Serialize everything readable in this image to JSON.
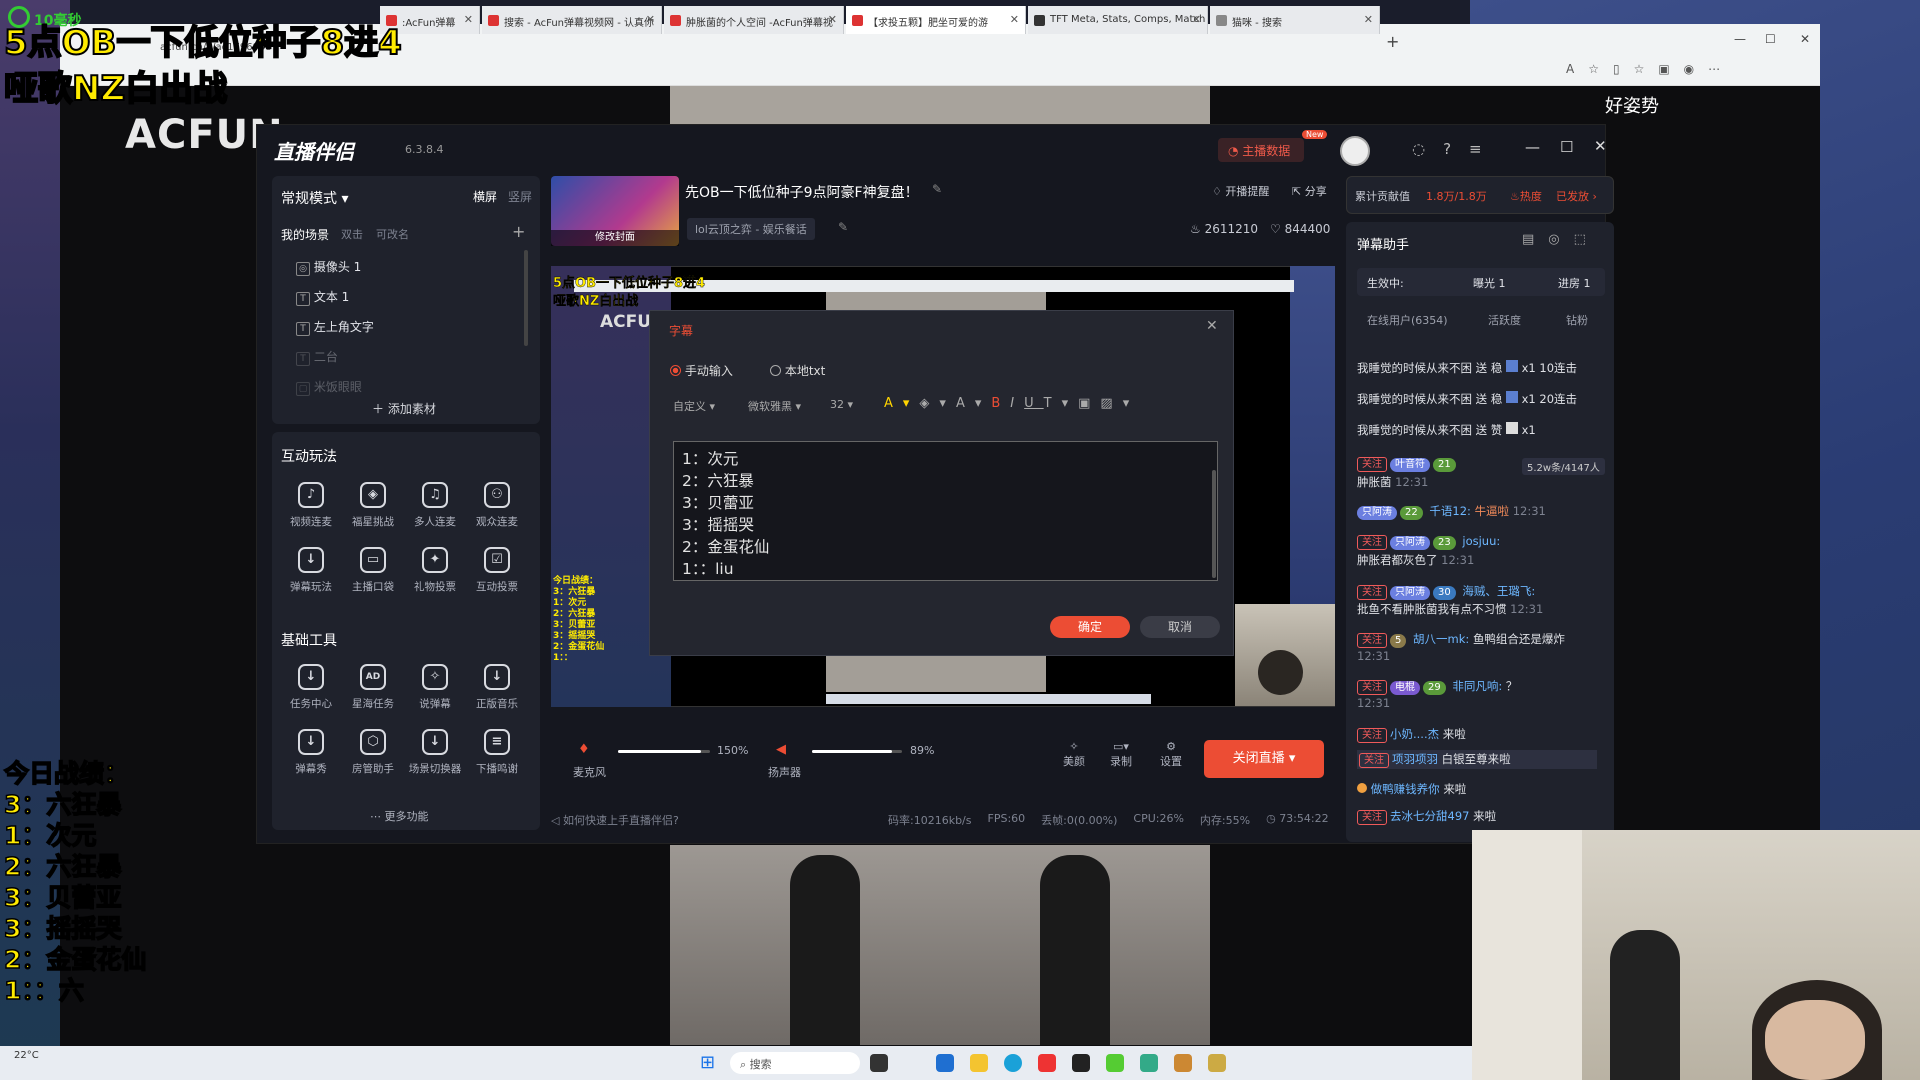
{
  "overlay": {
    "ring_label": "10毫秒",
    "title_line1": "5点OB一下低位种子8进4",
    "title_line2": "哑歌NZ白出战",
    "stats_title": "今日战绩：",
    "stats": [
      "3：六狂暴",
      "1：次元",
      "2：六狂暴",
      "3：贝蕾亚",
      "3：摇摇哭",
      "2：金蛋花仙",
      "1：：六"
    ]
  },
  "browser": {
    "tabs": [
      ":AcFun弹幕",
      "搜索 - AcFun弹幕视频网 - 认真你",
      "肿胀菌的个人空间 -AcFun弹幕视",
      "【求投五颗】肥坐可爱的游",
      "TFT Meta, Stats, Comps, Match H",
      "猫咪 - 搜索"
    ],
    "url": "acfun.cn/v/ac17969387",
    "new_tab": "+"
  },
  "page": {
    "logo": "ACFUN",
    "side_text": "好姿势"
  },
  "app": {
    "name": "直播伴侣",
    "version": "6.3.8.4",
    "host_data": "主播数据",
    "new_badge": "New",
    "mode": {
      "label": "常规模式",
      "landscape": "横屏",
      "portrait": "竖屏"
    },
    "scene": {
      "title": "我的场景",
      "double": "双击",
      "rename": "可改名",
      "add": "+",
      "items": [
        "摄像头 1",
        "文本 1",
        "左上角文字",
        "二台",
        "米饭眼眼"
      ],
      "add_material": "添加素材"
    },
    "interactive": {
      "title": "互动玩法",
      "items": [
        "视频连麦",
        "福星挑战",
        "多人连麦",
        "观众连麦",
        "弹幕玩法",
        "主播口袋",
        "礼物投票",
        "互动投票"
      ]
    },
    "tools": {
      "title": "基础工具",
      "items": [
        "任务中心",
        "星海任务",
        "说弹幕",
        "正版音乐",
        "弹幕秀",
        "房管助手",
        "场景切换器",
        "下播鸣谢"
      ],
      "more": "更多功能"
    },
    "stream": {
      "title": "先OB一下低位种子9点阿豪F神复盘！",
      "category": "lol云顶之弈 - 娱乐餐话",
      "change_cover": "修改封面",
      "notify": "开播提醒",
      "share": "分享",
      "likes": "2611210",
      "hearts": "844400"
    },
    "preview_text": {
      "title1": "5点OB一下低位种子8进4",
      "title2": "哑歌NZ白出战",
      "stats_title": "今日战绩：",
      "stats": [
        "3：六狂暴",
        "1：次元",
        "2：六狂暴",
        "3：贝蕾亚",
        "3：摇摇哭",
        "2：金蛋花仙",
        "1：："
      ]
    },
    "dialog": {
      "title": "字幕",
      "close": "✕",
      "radio_manual": "手动输入",
      "radio_file": "本地txt",
      "preset": "自定义",
      "font": "微软雅黑",
      "size": "32",
      "content_lines": [
        "1：次元",
        "2：六狂暴",
        "3：贝蕾亚",
        "3：摇摇哭",
        "2：金蛋花仙",
        "1：：liu"
      ],
      "confirm": "确定",
      "cancel": "取消"
    },
    "audio": {
      "mic_label": "麦克风",
      "mic_value": "150%",
      "mic_level": 0.9,
      "speaker_label": "扬声器",
      "speaker_value": "89%",
      "speaker_level": 0.89
    },
    "bottom_btns": {
      "beauty": "美颜",
      "record": "录制",
      "settings": "设置",
      "stop": "关闭直播"
    },
    "status": {
      "help": "如何快速上手直播伴侣?",
      "bitrate": "码率:10216kb/s",
      "fps": "FPS:60",
      "drop": "丢帧:0(0.00%)",
      "cpu": "CPU:26%",
      "mem": "内存:55%",
      "time": "73:54:22"
    },
    "right": {
      "contrib_label": "累计贡献值",
      "contrib_value": "1.8万/1.8万",
      "hot": "热度",
      "released": "已发放",
      "danmu_title": "弹幕助手",
      "effect": "生效中:",
      "exposure": "曝光 1",
      "enter": "进房 1",
      "tabs": [
        "在线用户(6354)",
        "活跃度",
        "钻粉"
      ],
      "gifts": [
        {
          "user": "我睡觉的时候从来不困",
          "act": "送 稳",
          "count": "x1",
          "combo": "10连击"
        },
        {
          "user": "我睡觉的时候从来不困",
          "act": "送 稳",
          "count": "x1",
          "combo": "20连击"
        },
        {
          "user": "我睡觉的时候从来不困",
          "act": "送 赞",
          "count": "x1",
          "combo": ""
        }
      ],
      "viewer_badge": "5.2w条/4147人",
      "chat": [
        {
          "tag": "关注",
          "badge": "叶音符",
          "lvl": "21",
          "name": "",
          "text": "肿胀菌",
          "time": "12:31"
        },
        {
          "tag": "",
          "badge": "只阿涛",
          "lvl": "22",
          "name": "千语12:",
          "text": "牛逼啦",
          "time": "12:31"
        },
        {
          "tag": "关注",
          "badge": "只阿涛",
          "lvl": "23",
          "name": "josjuu:",
          "text": "肿胀君都灰色了",
          "time": "12:31"
        },
        {
          "tag": "关注",
          "badge": "只阿涛",
          "lvl": "30",
          "name": "海贼、王璐飞:",
          "text": "批鱼不看肿胀菌我有点不习惯",
          "time": "12:31"
        },
        {
          "tag": "关注",
          "badge": "",
          "lvl": "5",
          "name": "胡八一mk:",
          "text": "鱼鸭组合还是爆炸",
          "time": "12:31"
        },
        {
          "tag": "关注",
          "badge": "电棍",
          "lvl": "29",
          "name": "非同凡响:",
          "text": "？",
          "time": "12:31"
        }
      ],
      "enters": [
        {
          "tag": "关注",
          "name": "小奶....杰",
          "act": "来啦"
        },
        {
          "tag": "关注",
          "name": "项羽项羽",
          "act": "白银至尊来啦"
        },
        {
          "tag": "",
          "name": "做鸭赚钱养你",
          "act": "来啦"
        },
        {
          "tag": "关注",
          "name": "去冰七分甜497",
          "act": "来啦"
        }
      ]
    }
  },
  "taskbar": {
    "weather": "22°C",
    "search": "搜索"
  },
  "colors": {
    "accent": "#ec4d34",
    "overlay_yellow": "#ffeb00"
  }
}
